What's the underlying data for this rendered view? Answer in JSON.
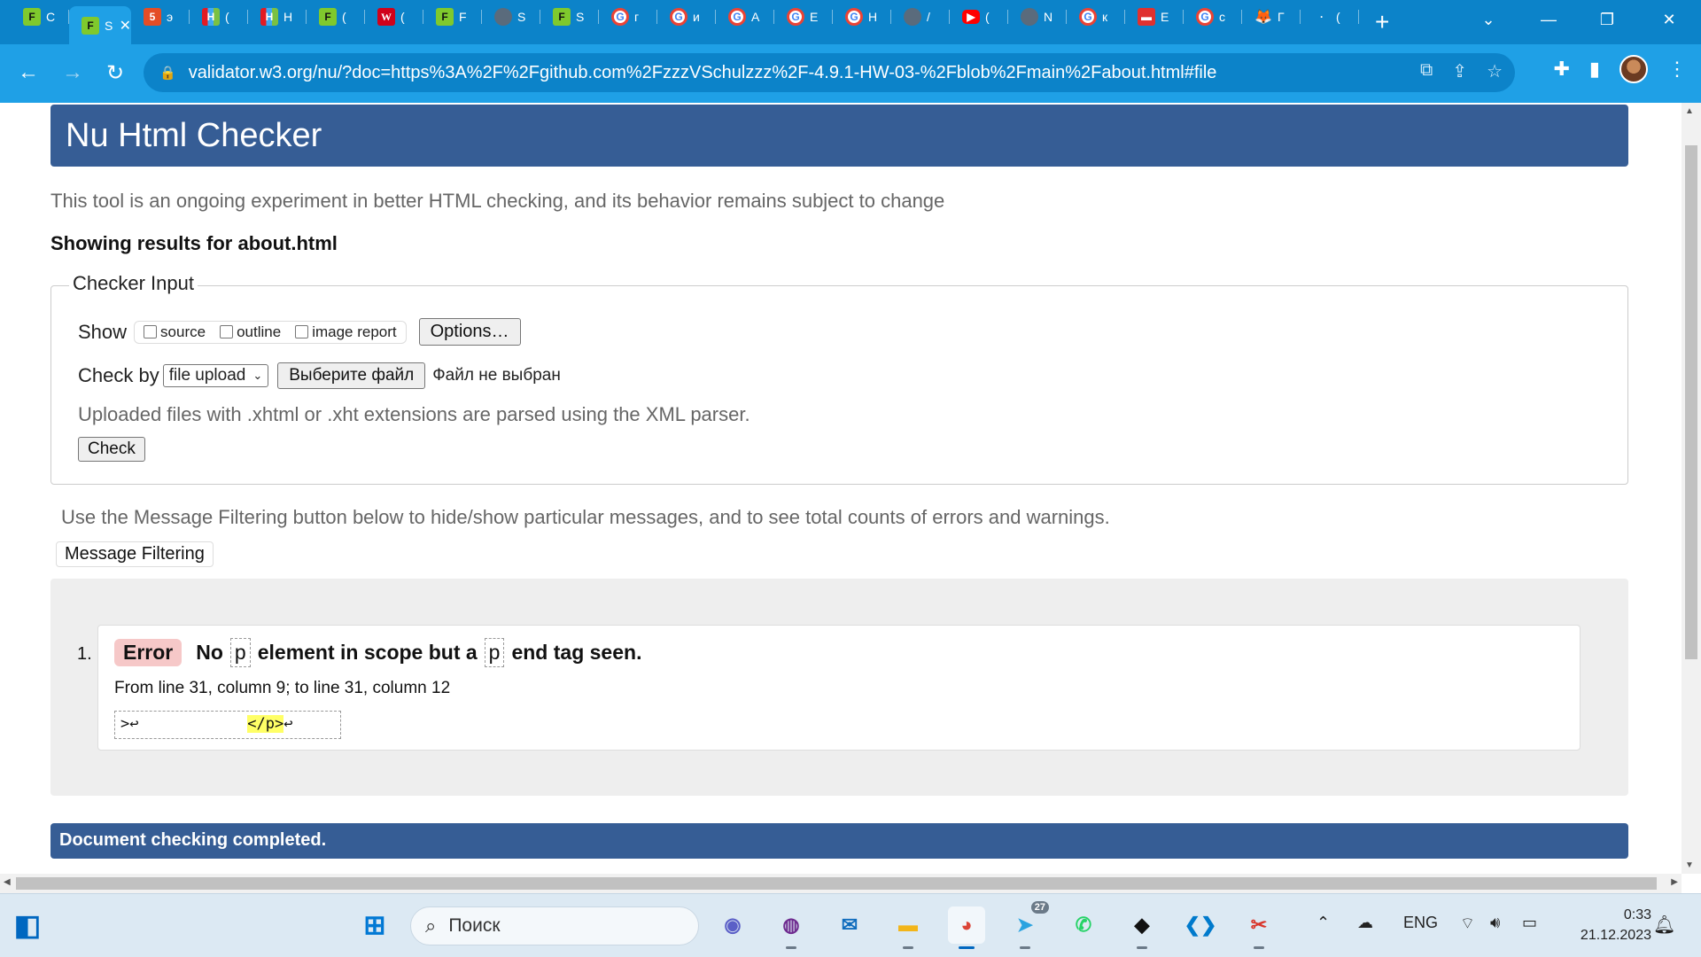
{
  "browser": {
    "tabs": [
      {
        "favicon": "fav-green",
        "glyph": "F",
        "short": "C"
      },
      {
        "favicon": "fav-green",
        "glyph": "F",
        "short": "S",
        "active": true
      },
      {
        "favicon": "html5",
        "glyph": "5",
        "short": "э"
      },
      {
        "favicon": "multi",
        "glyph": "H",
        "short": "("
      },
      {
        "favicon": "multi",
        "glyph": "H",
        "short": "H"
      },
      {
        "favicon": "fav-green",
        "glyph": "F",
        "short": "("
      },
      {
        "favicon": "w",
        "glyph": "W",
        "short": "("
      },
      {
        "favicon": "fav-green",
        "glyph": "F",
        "short": "F"
      },
      {
        "favicon": "github",
        "glyph": "",
        "short": "S"
      },
      {
        "favicon": "fav-green",
        "glyph": "F",
        "short": "S"
      },
      {
        "favicon": "google",
        "glyph": "G",
        "short": "г"
      },
      {
        "favicon": "google",
        "glyph": "G",
        "short": "и"
      },
      {
        "favicon": "google",
        "glyph": "G",
        "short": "А"
      },
      {
        "favicon": "google",
        "glyph": "G",
        "short": "Е"
      },
      {
        "favicon": "google",
        "glyph": "G",
        "short": "Н"
      },
      {
        "favicon": "github",
        "glyph": "",
        "short": "/"
      },
      {
        "favicon": "youtube",
        "glyph": "▶",
        "short": "("
      },
      {
        "favicon": "github",
        "glyph": "",
        "short": "N"
      },
      {
        "favicon": "google",
        "glyph": "G",
        "short": "к"
      },
      {
        "favicon": "red",
        "glyph": "▬",
        "short": "E"
      },
      {
        "favicon": "google",
        "glyph": "G",
        "short": "с"
      },
      {
        "favicon": "fox",
        "glyph": "🦊",
        "short": "Г"
      },
      {
        "favicon": "dot",
        "glyph": "·",
        "short": "("
      }
    ],
    "new_tab": "+",
    "url": "validator.w3.org/nu/?doc=https%3A%2F%2Fgithub.com%2FzzzVSchulzzz%2F-4.9.1-HW-03-%2Fblob%2Fmain%2Fabout.html#file"
  },
  "page": {
    "title": "Nu Html Checker",
    "intro": "This tool is an ongoing experiment in better HTML checking, and its behavior remains subject to change",
    "results_for": "Showing results for about.html",
    "checker_input": {
      "legend": "Checker Input",
      "show_label": "Show",
      "checkboxes": [
        "source",
        "outline",
        "image report"
      ],
      "options_button": "Options…",
      "check_by_label": "Check by",
      "check_by_value": "file upload",
      "file_button": "Выберите файл",
      "file_status": "Файл не выбран",
      "note": "Uploaded files with .xhtml or .xht extensions are parsed using the XML parser.",
      "check_button": "Check"
    },
    "filter_note": "Use the Message Filtering button below to hide/show particular messages, and to see total counts of errors and warnings.",
    "filter_button": "Message Filtering",
    "messages": [
      {
        "number": "1.",
        "type": "Error",
        "text_1": "No",
        "token_1": "p",
        "text_2": "element in scope but a",
        "token_2": "p",
        "text_3": "end tag seen.",
        "location": "From line 31, column 9; to line 31, column 12",
        "extract_pre": ">↩            ",
        "extract_hl": "</p>",
        "extract_post": "↩"
      }
    ],
    "done": "Document checking completed."
  },
  "taskbar": {
    "search_placeholder": "Поиск",
    "telegram_badge": "27",
    "lang": "ENG",
    "time": "0:33",
    "date": "21.12.2023"
  },
  "colors": {
    "chrome_tabstrip": "#0c83c9",
    "chrome_toolbar": "#1fa0e6",
    "validator_blue": "#365d95",
    "error_badge": "#f6c8c8",
    "highlight": "#ffff66"
  }
}
